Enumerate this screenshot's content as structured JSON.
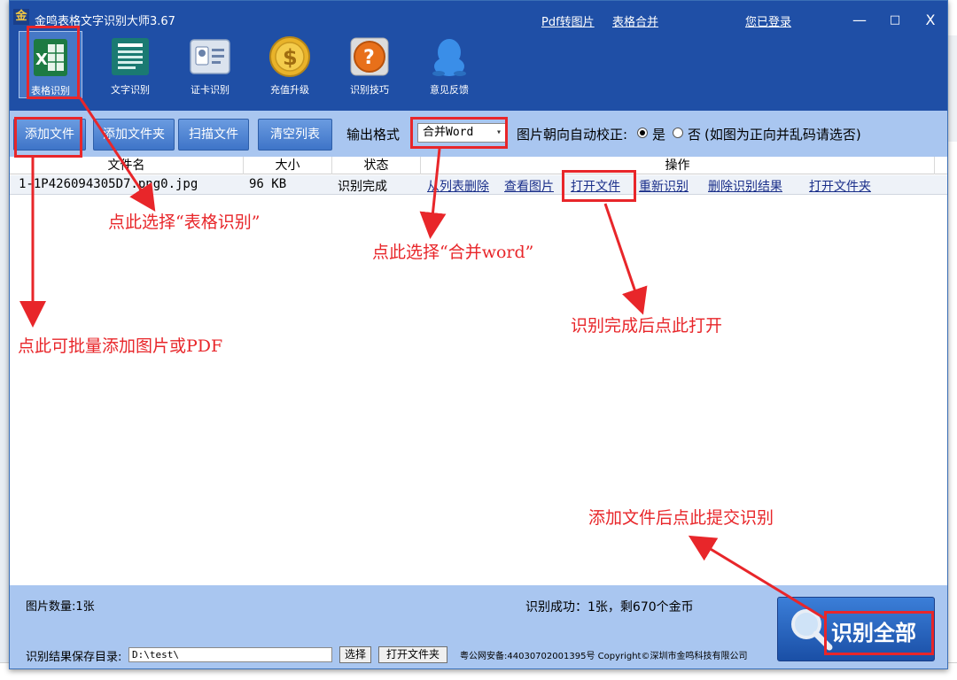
{
  "window": {
    "title": "金鸣表格文字识别大师3.67",
    "logo_char": "金",
    "links": [
      "Pdf转图片",
      "表格合并",
      "您已登录"
    ],
    "controls": {
      "minimize": "—",
      "maximize": "□",
      "close": "X"
    }
  },
  "tools": [
    {
      "label": "表格识别",
      "icon": "excel-icon",
      "active": true
    },
    {
      "label": "文字识别",
      "icon": "document-icon"
    },
    {
      "label": "证卡识别",
      "icon": "id-card-icon"
    },
    {
      "label": "充值升级",
      "icon": "coin-icon"
    },
    {
      "label": "识别技巧",
      "icon": "help-icon"
    },
    {
      "label": "意见反馈",
      "icon": "qq-icon"
    }
  ],
  "toolbar": {
    "buttons": [
      "添加文件",
      "添加文件夹",
      "扫描文件",
      "清空列表"
    ],
    "output_label": "输出格式",
    "output_value": "合并Word",
    "orient_label": "图片朝向自动校正:",
    "orient_yes": "是",
    "orient_no": "否",
    "orient_note": "(如图为正向并乱码请选否)"
  },
  "table": {
    "headers": [
      "文件名",
      "大小",
      "状态",
      "操作"
    ],
    "row": {
      "filename": "1-1P426094305D7.png0.jpg",
      "size": "96 KB",
      "status": "识别完成",
      "actions": [
        "从列表删除",
        "查看图片",
        "打开文件",
        "重新识别",
        "删除识别结果",
        "打开文件夹"
      ]
    }
  },
  "footer": {
    "count": "图片数量:1张",
    "result": "识别成功：1张，剩670个金币",
    "save_label": "识别结果保存目录:",
    "save_path": "D:\\test\\",
    "choose": "选择",
    "open_folder": "打开文件夹",
    "copyright": "粤公网安备:44030702001395号 Copyright©深圳市金鸣科技有限公司",
    "recognize_all": "识别全部"
  },
  "annotations": [
    "点此选择“表格识别”",
    "点此选择“合并word”",
    "点此可批量添加图片或PDF",
    "识别完成后点此打开",
    "添加文件后点此提交识别"
  ],
  "colors": {
    "title_bar": "#1f4fa6",
    "toolbar": "#a9c6f0",
    "annotation": "#e8262a",
    "link": "#1a2f8a"
  }
}
